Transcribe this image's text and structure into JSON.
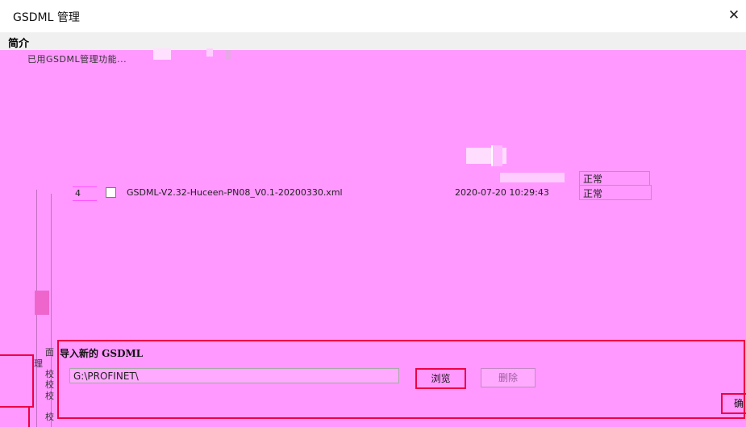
{
  "window": {
    "title": "GSDML 管理",
    "close_glyph": "✕"
  },
  "intro": {
    "label": "简介",
    "fragment": "已用GSDML管理功能..."
  },
  "table": {
    "rows": [
      {
        "index": "",
        "filename": "",
        "date": "",
        "status": "正常"
      },
      {
        "index": "4",
        "filename": "GSDML-V2.32-Huceen-PN08_V0.1-20200330.xml",
        "date": "2020-07-20 10:29:43",
        "status": "正常"
      }
    ]
  },
  "import_section": {
    "title": "导入新的 GSDML",
    "path_value": "G:\\PROFINET\\",
    "browse_label": "浏览",
    "delete_label": "删除",
    "ok_label": "确"
  },
  "side": {
    "glyphs": [
      "面",
      "理",
      "校",
      "校",
      "校",
      "校"
    ]
  },
  "colors": {
    "background": "#ff99ff",
    "accent_border": "#ee0044",
    "titlebar": "#ffffff"
  }
}
